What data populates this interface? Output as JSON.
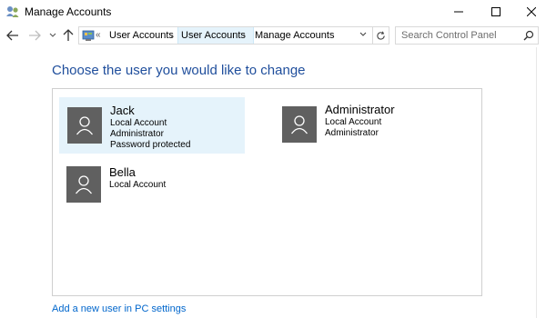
{
  "window": {
    "title": "Manage Accounts",
    "controls": {
      "minimize": "minimize-icon",
      "maximize": "maximize-icon",
      "close": "close-icon"
    }
  },
  "nav": {
    "back_icon": "arrow-left-icon",
    "forward_icon": "arrow-right-icon",
    "recent_icon": "chevron-down-icon",
    "up_icon": "arrow-up-icon",
    "refresh_icon": "refresh-icon"
  },
  "address": {
    "overflow": "«",
    "crumbs": [
      "User Accounts",
      "User Accounts",
      "Manage Accounts"
    ]
  },
  "search": {
    "placeholder": "Search Control Panel"
  },
  "main": {
    "heading": "Choose the user you would like to change",
    "accounts": [
      {
        "name": "Jack",
        "details": [
          "Local Account",
          "Administrator",
          "Password protected"
        ],
        "selected": true
      },
      {
        "name": "Administrator",
        "details": [
          "Local Account",
          "Administrator"
        ],
        "selected": false
      },
      {
        "name": "Bella",
        "details": [
          "Local Account"
        ],
        "selected": false
      }
    ],
    "add_user_link": "Add a new user in PC settings"
  },
  "colors": {
    "heading": "#1f4e9c",
    "link": "#0066cc",
    "selection": "#e5f3fb",
    "avatar": "#606060"
  }
}
